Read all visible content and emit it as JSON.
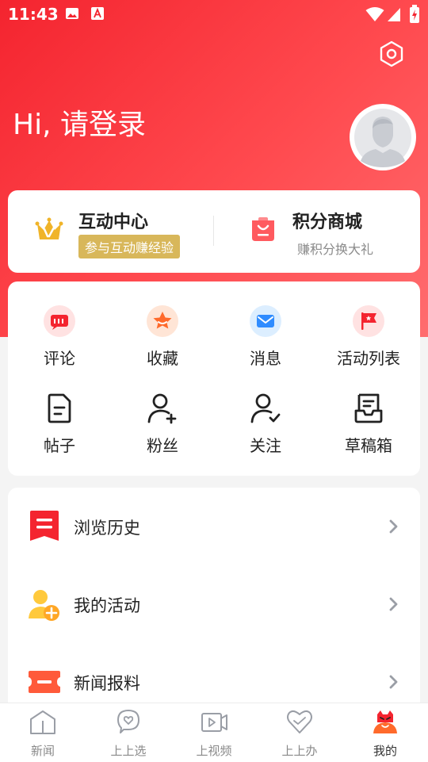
{
  "status_bar": {
    "time": "11:43"
  },
  "header": {
    "greeting": "Hi, 请登录"
  },
  "top_card": {
    "left": {
      "title": "互动中心",
      "badge": "参与互动赚经验"
    },
    "right": {
      "title": "积分商城",
      "subtitle": "赚积分换大礼"
    }
  },
  "grid": {
    "row1": [
      {
        "label": "评论"
      },
      {
        "label": "收藏"
      },
      {
        "label": "消息"
      },
      {
        "label": "活动列表"
      }
    ],
    "row2": [
      {
        "label": "帖子"
      },
      {
        "label": "粉丝"
      },
      {
        "label": "关注"
      },
      {
        "label": "草稿箱"
      }
    ]
  },
  "list": [
    {
      "label": "浏览历史"
    },
    {
      "label": "我的活动"
    },
    {
      "label": "新闻报料"
    }
  ],
  "tabs": [
    {
      "label": "新闻"
    },
    {
      "label": "上上选"
    },
    {
      "label": "上视频"
    },
    {
      "label": "上上办"
    },
    {
      "label": "我的"
    }
  ],
  "colors": {
    "brand_red": "#f4242f",
    "badge_gold": "#d8b75a",
    "chevron": "#9a9ea6",
    "tab_inactive": "#8a8a8a"
  }
}
